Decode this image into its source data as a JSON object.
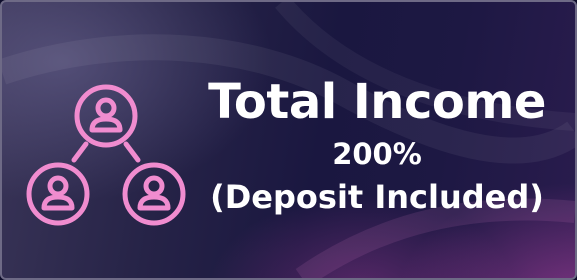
{
  "card": {
    "icon": "referral-network-icon",
    "title": "Total Income",
    "percent": "200%",
    "note": "(Deposit Included)"
  },
  "colors": {
    "icon_pink": "#f08ccf",
    "text": "#ffffff",
    "border": "#6e6a86",
    "background_dark": "#1a1740"
  }
}
